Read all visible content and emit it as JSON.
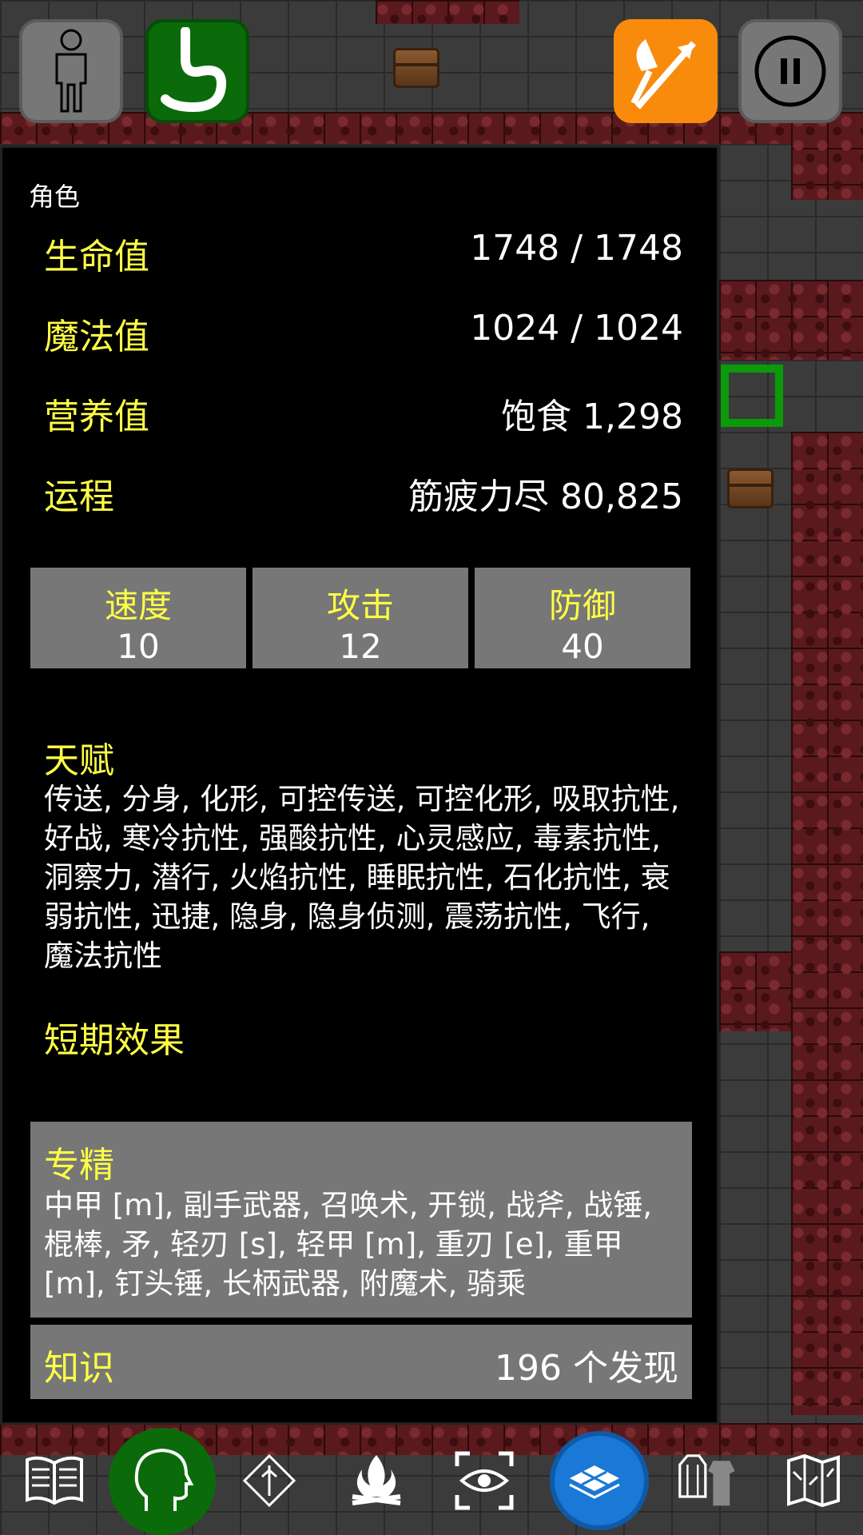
{
  "panel": {
    "title": "角色",
    "stats": [
      {
        "label": "生命值",
        "value": "1748 / 1748"
      },
      {
        "label": "魔法值",
        "value": "1024 / 1024"
      },
      {
        "label": "营养值",
        "value": "饱食 1,298"
      },
      {
        "label": "运程",
        "value": "筋疲力尽 80,825"
      }
    ],
    "attributes": [
      {
        "label": "速度",
        "value": "10"
      },
      {
        "label": "攻击",
        "value": "12"
      },
      {
        "label": "防御",
        "value": "40"
      }
    ],
    "talents": {
      "heading": "天赋",
      "text": "传送, 分身, 化形, 可控传送, 可控化形, 吸取抗性, 好战, 寒冷抗性, 强酸抗性, 心灵感应, 毒素抗性, 洞察力, 潜行, 火焰抗性, 睡眠抗性, 石化抗性, 衰弱抗性, 迅捷, 隐身, 隐身侦测, 震荡抗性, 飞行, 魔法抗性"
    },
    "short_effects": {
      "heading": "短期效果"
    },
    "expertise": {
      "heading": "专精",
      "text": "中甲 [m], 副手武器, 召唤术, 开锁, 战斧, 战锤, 棍棒, 矛, 轻刃 [s], 轻甲 [m], 重刃 [e], 重甲 [m], 钉头锤, 长柄武器, 附魔术, 骑乘"
    },
    "knowledge": {
      "label": "知识",
      "value": "196 个发现"
    }
  },
  "top_buttons": [
    {
      "icon": "character-icon",
      "color": "#777777"
    },
    {
      "icon": "stomach-icon",
      "color": "#0b6b0b"
    },
    {
      "icon": "bow-arrow-icon",
      "color": "#f98b0c"
    },
    {
      "icon": "pause-icon",
      "color": "#777777"
    }
  ],
  "bottom_icons": [
    "book-icon",
    "head-icon",
    "spell-icon",
    "campfire-icon",
    "look-icon",
    "map-tiles-icon",
    "equipment-icon",
    "map-icon"
  ]
}
